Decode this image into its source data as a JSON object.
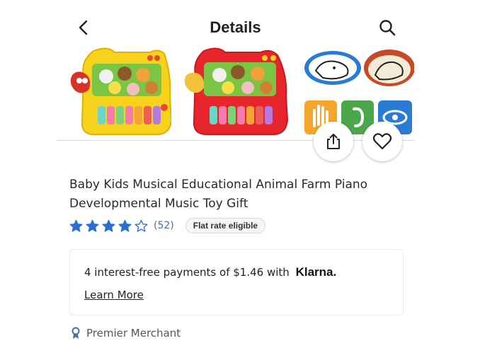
{
  "header": {
    "title": "Details",
    "back_icon": "chevron-left-icon",
    "search_icon": "search-icon"
  },
  "gallery": {
    "images": [
      {
        "name": "yellow-animal-piano-toy"
      },
      {
        "name": "red-animal-piano-toy"
      },
      {
        "name": "developmental-sensory-illustrations"
      }
    ],
    "share_icon": "share-icon",
    "favorite_icon": "heart-icon"
  },
  "product": {
    "title_line1": "Baby Kids Musical Educational Animal Farm Piano",
    "title_line2": "Developmental Music Toy Gift",
    "rating": 4,
    "rating_max": 5,
    "review_count": "(52)",
    "badge": "Flat rate eligible"
  },
  "klarna": {
    "text": "4 interest-free payments of $1.46 with",
    "brand": "Klarna.",
    "link": "Learn More"
  },
  "merchant": {
    "icon": "ribbon-icon",
    "label": "Premier Merchant"
  },
  "colors": {
    "star": "#2d6fd0",
    "text": "#222222",
    "link_count": "#4b6f9c"
  }
}
